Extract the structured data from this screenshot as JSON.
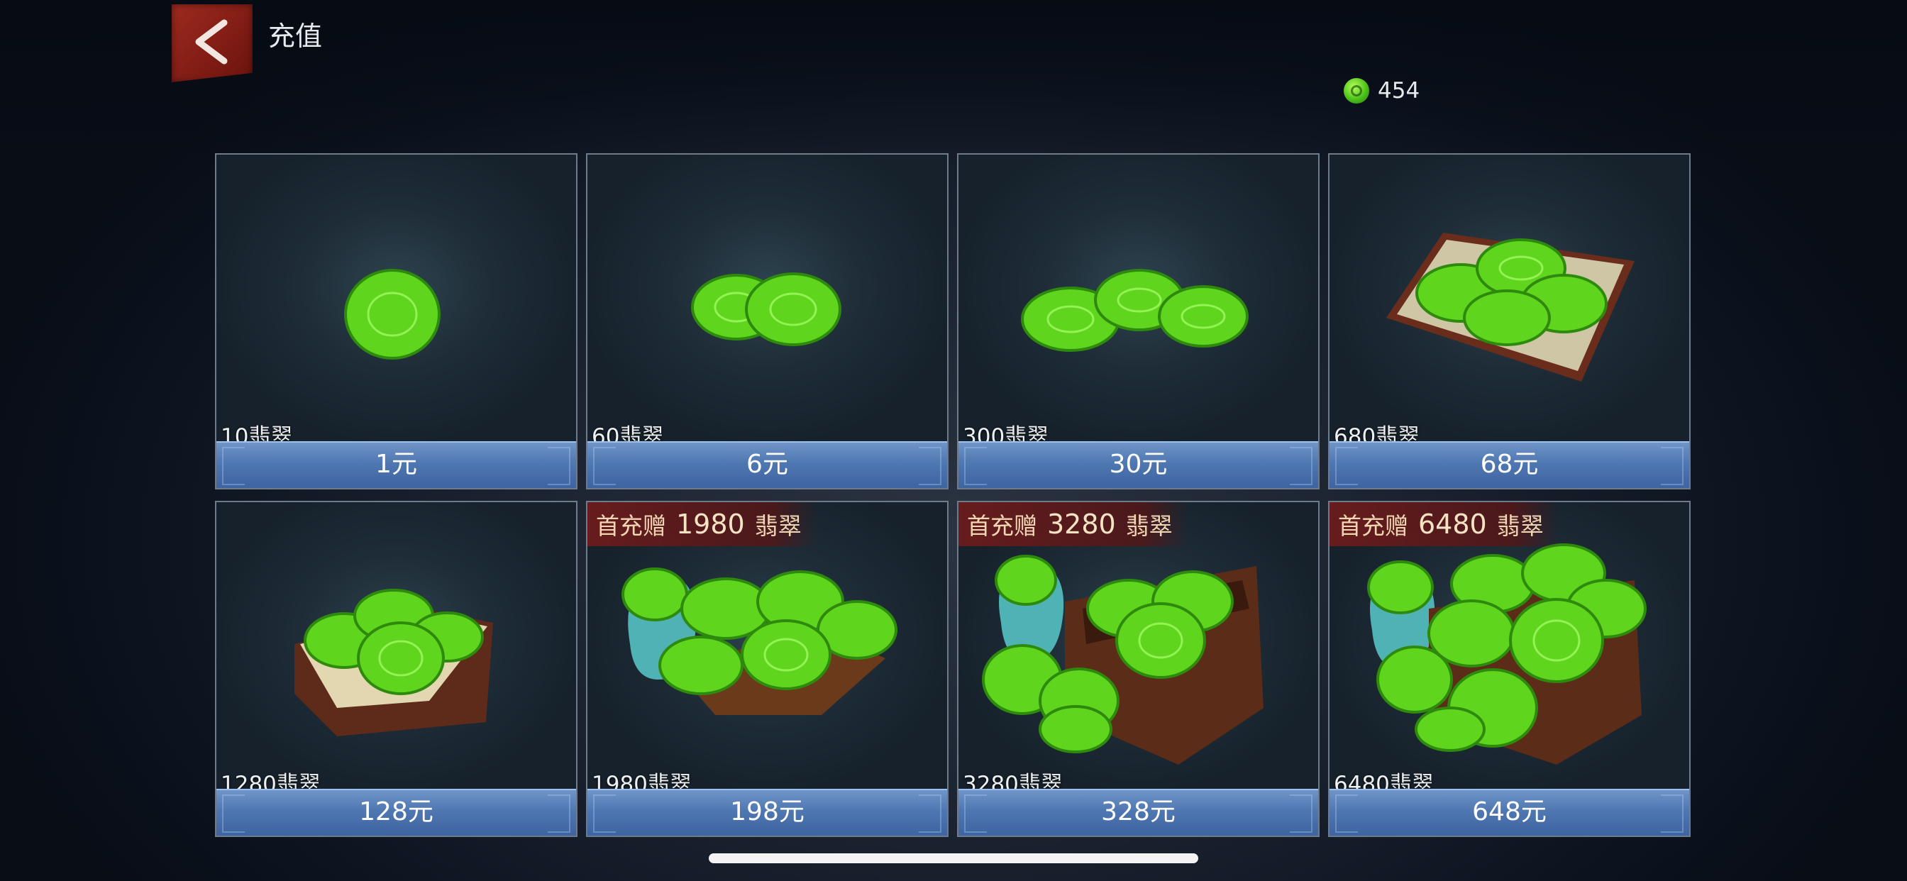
{
  "header": {
    "title": "充值"
  },
  "balance": {
    "value": "454"
  },
  "packages": [
    {
      "amount": "10翡翠",
      "price": "1元"
    },
    {
      "amount": "60翡翠",
      "price": "6元"
    },
    {
      "amount": "300翡翠",
      "price": "30元"
    },
    {
      "amount": "680翡翠",
      "price": "68元"
    },
    {
      "amount": "1280翡翠",
      "price": "128元"
    },
    {
      "amount": "1980翡翠",
      "price": "198元",
      "bonus": {
        "prefix": "首充赠",
        "value": "1980",
        "unit": "翡翠"
      }
    },
    {
      "amount": "3280翡翠",
      "price": "328元",
      "bonus": {
        "prefix": "首充赠",
        "value": "3280",
        "unit": "翡翠"
      }
    },
    {
      "amount": "6480翡翠",
      "price": "648元",
      "bonus": {
        "prefix": "首充赠",
        "value": "6480",
        "unit": "翡翠"
      }
    }
  ],
  "colors": {
    "accent": "#4f77b1",
    "jade": "#5fd51e",
    "back_button": "#9e2a1f"
  }
}
